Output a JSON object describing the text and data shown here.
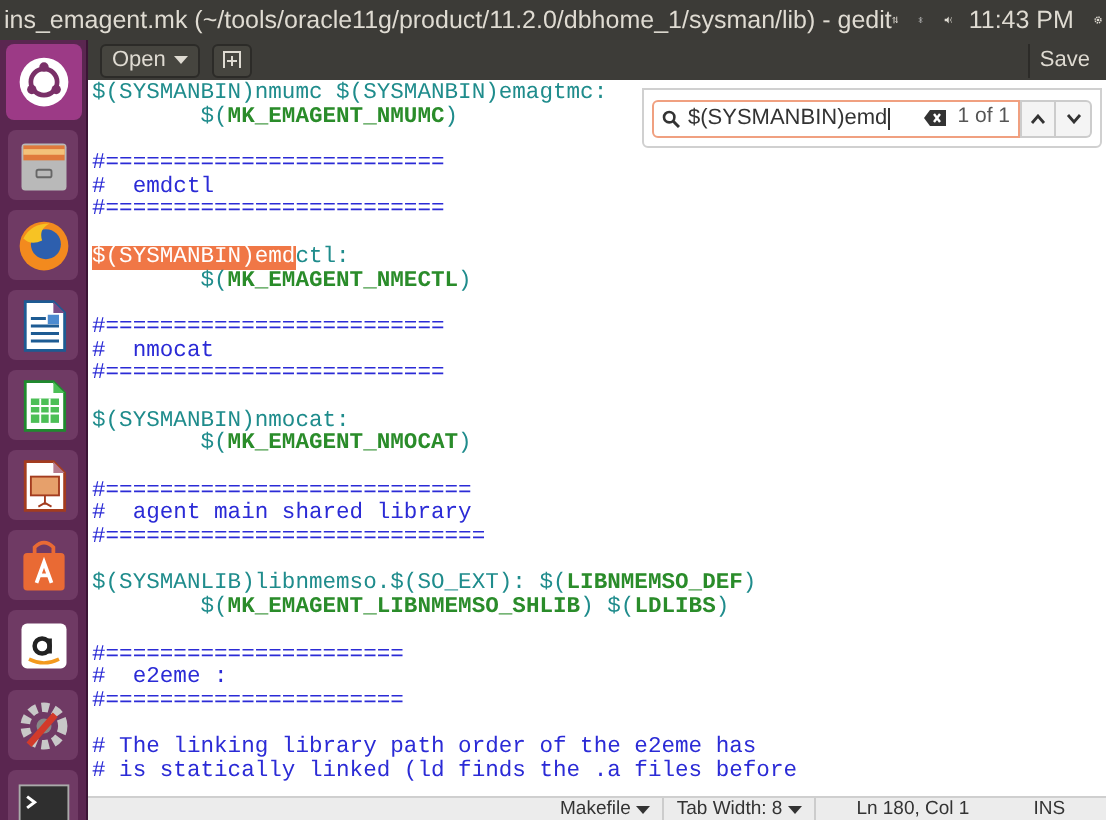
{
  "top_panel": {
    "title": "ins_emagent.mk (~/tools/oracle11g/product/11.2.0/dbhome_1/sysman/lib) - gedit",
    "clock": "11:43 PM"
  },
  "launcher": [
    {
      "kind": "ubuntu",
      "selected": true
    },
    {
      "kind": "files",
      "selected": false
    },
    {
      "kind": "firefox",
      "selected": false
    },
    {
      "kind": "writer",
      "selected": false
    },
    {
      "kind": "calc",
      "selected": false
    },
    {
      "kind": "impress",
      "selected": false
    },
    {
      "kind": "software",
      "selected": false
    },
    {
      "kind": "amazon",
      "selected": false
    },
    {
      "kind": "settings",
      "selected": false
    },
    {
      "kind": "terminal",
      "selected": false
    }
  ],
  "header_bar": {
    "open_button": "Open",
    "save_button": "Save"
  },
  "search": {
    "value": "$(SYSMANBIN)emd",
    "count": "1 of 1"
  },
  "lines": [
    {
      "kind": "code",
      "segments": [
        {
          "kind": "var",
          "text": "$(SYSMANBIN)nmumc $(SYSMANBIN)emagtmc:"
        }
      ]
    },
    {
      "kind": "code",
      "segments": [
        {
          "kind": "var",
          "text": "\t$("
        },
        {
          "kind": "name",
          "text": "MK_EMAGENT_NMUMC"
        },
        {
          "kind": "var",
          "text": ")"
        }
      ]
    },
    {
      "kind": "blank"
    },
    {
      "kind": "code",
      "segments": [
        {
          "kind": "comment",
          "text": "#========================="
        }
      ]
    },
    {
      "kind": "code",
      "segments": [
        {
          "kind": "comment",
          "text": "#  emdctl"
        }
      ]
    },
    {
      "kind": "code",
      "segments": [
        {
          "kind": "comment",
          "text": "#========================="
        }
      ]
    },
    {
      "kind": "blank"
    },
    {
      "kind": "code",
      "segments": [
        {
          "kind": "match",
          "text": "$(SYSMANBIN)emd"
        },
        {
          "kind": "var",
          "text": "ctl:"
        }
      ]
    },
    {
      "kind": "code",
      "segments": [
        {
          "kind": "var",
          "text": "\t$("
        },
        {
          "kind": "name",
          "text": "MK_EMAGENT_NMECTL"
        },
        {
          "kind": "var",
          "text": ")"
        }
      ]
    },
    {
      "kind": "blank"
    },
    {
      "kind": "code",
      "segments": [
        {
          "kind": "comment",
          "text": "#========================="
        }
      ]
    },
    {
      "kind": "code",
      "segments": [
        {
          "kind": "comment",
          "text": "#  nmocat"
        }
      ]
    },
    {
      "kind": "code",
      "segments": [
        {
          "kind": "comment",
          "text": "#========================="
        }
      ]
    },
    {
      "kind": "blank"
    },
    {
      "kind": "code",
      "segments": [
        {
          "kind": "var",
          "text": "$(SYSMANBIN)nmocat:"
        }
      ]
    },
    {
      "kind": "code",
      "segments": [
        {
          "kind": "var",
          "text": "\t$("
        },
        {
          "kind": "name",
          "text": "MK_EMAGENT_NMOCAT"
        },
        {
          "kind": "var",
          "text": ")"
        }
      ]
    },
    {
      "kind": "blank"
    },
    {
      "kind": "code",
      "segments": [
        {
          "kind": "comment",
          "text": "#==========================="
        }
      ]
    },
    {
      "kind": "code",
      "segments": [
        {
          "kind": "comment",
          "text": "#  agent main shared library"
        }
      ]
    },
    {
      "kind": "code",
      "segments": [
        {
          "kind": "comment",
          "text": "#============================"
        }
      ]
    },
    {
      "kind": "blank"
    },
    {
      "kind": "code",
      "segments": [
        {
          "kind": "var",
          "text": "$(SYSMANLIB)libnmemso.$(SO_EXT): $("
        },
        {
          "kind": "name",
          "text": "LIBNMEMSO_DEF"
        },
        {
          "kind": "var",
          "text": ")"
        }
      ]
    },
    {
      "kind": "code",
      "segments": [
        {
          "kind": "var",
          "text": "\t$("
        },
        {
          "kind": "name",
          "text": "MK_EMAGENT_LIBNMEMSO_SHLIB"
        },
        {
          "kind": "var",
          "text": ") $("
        },
        {
          "kind": "name",
          "text": "LDLIBS"
        },
        {
          "kind": "var",
          "text": ")"
        }
      ]
    },
    {
      "kind": "blank"
    },
    {
      "kind": "code",
      "segments": [
        {
          "kind": "comment",
          "text": "#======================"
        }
      ]
    },
    {
      "kind": "code",
      "segments": [
        {
          "kind": "comment",
          "text": "#  e2eme :"
        }
      ]
    },
    {
      "kind": "code",
      "segments": [
        {
          "kind": "comment",
          "text": "#======================"
        }
      ]
    },
    {
      "kind": "blank"
    },
    {
      "kind": "code",
      "segments": [
        {
          "kind": "comment",
          "text": "# The linking library path order of the e2eme has"
        }
      ]
    },
    {
      "kind": "code",
      "segments": [
        {
          "kind": "comment",
          "text": "# is statically linked (ld finds the .a files before"
        }
      ]
    }
  ],
  "status_bar": {
    "language": "Makefile",
    "tab_width": "Tab Width: 8",
    "position": "Ln 180, Col 1",
    "mode": "INS"
  }
}
